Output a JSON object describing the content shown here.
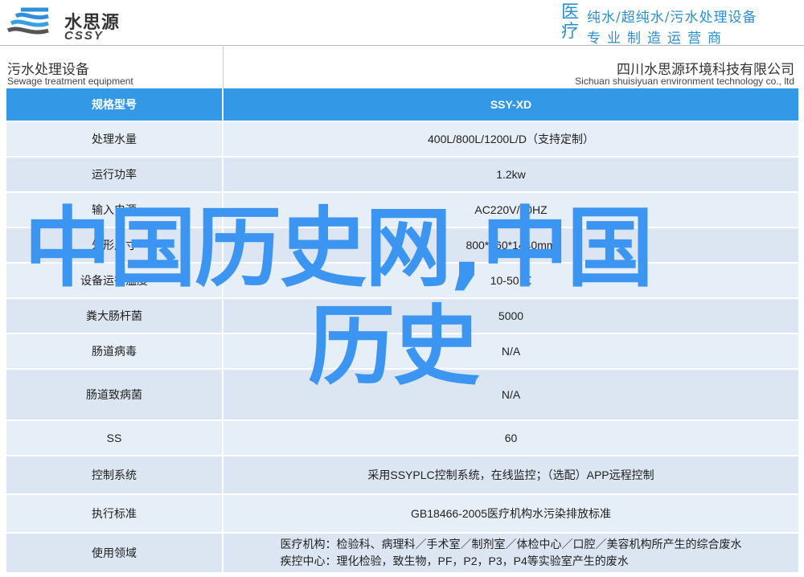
{
  "header": {
    "logo_cn": "水思源",
    "logo_en": "CSSY",
    "slogan_side": "医疗",
    "slogan_line1": "纯水/超纯水/污水处理设备",
    "slogan_line2": "专业制造运营商"
  },
  "titlebar": {
    "title_cn": "污水处理设备",
    "title_en": "Sewage treatment equipment",
    "company_cn": "四川水思源环境科技有限公司",
    "company_en": "Sichuan shuisiyuan environment technology co., ltd"
  },
  "table": {
    "header": {
      "label": "规格型号",
      "value": "SSY-XD"
    },
    "rows": [
      {
        "label": "处理水量",
        "value": "400L/800L/1200L/D（支持定制）"
      },
      {
        "label": "运行功率",
        "value": "1.2kw"
      },
      {
        "label": "输入电源",
        "value": "AC220V/50HZ"
      },
      {
        "label": "外形尺寸",
        "value": "800*960*1440mm"
      },
      {
        "label": "设备运行温度",
        "value": "10-50℃"
      },
      {
        "label": "粪大肠杆菌",
        "value": "5000"
      },
      {
        "label": "肠道病毒",
        "value": "N/A"
      },
      {
        "label": "肠道致病菌",
        "value": "N/A"
      },
      {
        "label": "SS",
        "value": "60"
      },
      {
        "label": "控制系统",
        "value": "采用SSYPLC控制系统，在线监控；（选配）APP远程控制"
      },
      {
        "label": "执行标准",
        "value": "GB18466-2005医疗机构水污染排放标准"
      },
      {
        "label": "使用领域",
        "value_line1": "医疗机构：检验科、病理科／手术室／制剂室／体检中心／口腔／美容机构所产生的综合废水",
        "value_line2": "疾控中心：理化检验，致生物，PF，P2，P3，P4等实验室产生的废水"
      }
    ]
  },
  "watermark": {
    "line1": "中国历史网,中国",
    "line2": "历史"
  },
  "colors": {
    "accent": "#3399e6",
    "row_light": "#e6eef7",
    "row_dark": "#dce6f2",
    "watermark": "#3d95f2",
    "slogan": "#2a8fd1"
  }
}
